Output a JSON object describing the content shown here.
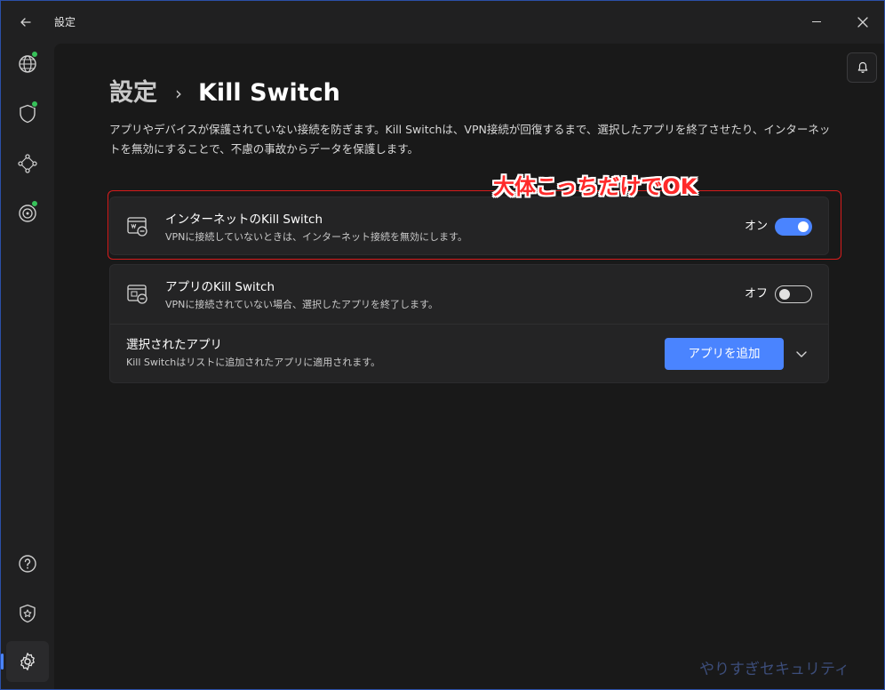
{
  "window": {
    "title": "設定"
  },
  "rail": {
    "items": [
      {
        "name": "globe-icon",
        "has_status_dot": true
      },
      {
        "name": "shield-icon",
        "has_status_dot": true
      },
      {
        "name": "nodes-icon",
        "has_status_dot": false
      },
      {
        "name": "radar-icon",
        "has_status_dot": true
      }
    ],
    "bottom_items": [
      {
        "name": "help-icon"
      },
      {
        "name": "star-shield-icon"
      },
      {
        "name": "gear-icon",
        "active": true
      }
    ],
    "status_color": "#37c25a",
    "active_indicator_color": "#4a84ff"
  },
  "header": {
    "breadcrumb_root": "設定",
    "breadcrumb_separator": "›",
    "breadcrumb_current": "Kill Switch"
  },
  "description": "アプリやデバイスが保護されていない接続を防ぎます。Kill Switchは、VPN接続が回復するまで、選択したアプリを終了させたり、インターネットを無効にすることで、不慮の事故からデータを保護します。",
  "annotation": "大体こっちだけでOK",
  "internet_kill_switch": {
    "title": "インターネットのKill Switch",
    "subtitle": "VPNに接続していないときは、インターネット接続を無効にします。",
    "state_label": "オン",
    "enabled": true
  },
  "app_kill_switch": {
    "title": "アプリのKill Switch",
    "subtitle": "VPNに接続されていない場合、選択したアプリを終了します。",
    "state_label": "オフ",
    "enabled": false
  },
  "selected_apps": {
    "title": "選択されたアプリ",
    "subtitle": "Kill Switchはリストに追加されたアプリに適用されます。",
    "add_button_label": "アプリを追加"
  },
  "watermark": "やりすぎセキュリティ",
  "colors": {
    "accent": "#4a84ff",
    "annotation_red": "#ff2a2a",
    "highlight_border": "#d81c1c",
    "background": "#191919"
  }
}
